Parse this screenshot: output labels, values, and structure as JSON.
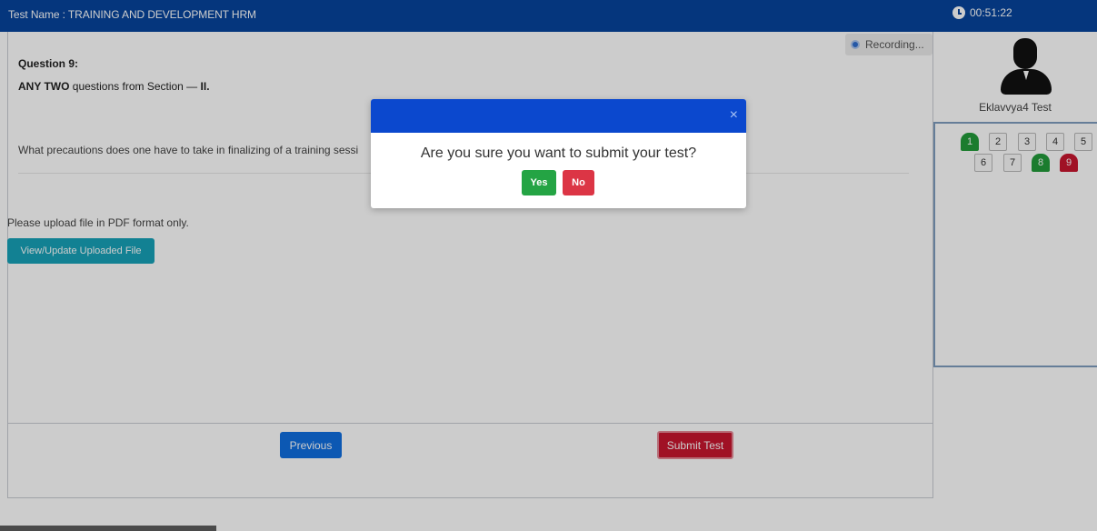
{
  "header": {
    "test_name": "Test Name : TRAINING AND DEVELOPMENT HRM",
    "timer": "00:51:22"
  },
  "recording": {
    "label": "Recording..."
  },
  "question": {
    "title": "Question 9:",
    "instruction_bold": "ANY TWO",
    "instruction_rest": " questions from Section — ",
    "instruction_section": "II.",
    "text": "What precautions does one have to take in finalizing of a training sessi"
  },
  "upload": {
    "note": "Please upload file in PDF format only.",
    "button_label": "View/Update Uploaded File"
  },
  "footer": {
    "previous_label": "Previous",
    "submit_label": "Submit Test"
  },
  "profile": {
    "name": "Eklavvya4 Test"
  },
  "palette": {
    "items": [
      {
        "num": "1",
        "state": "answered"
      },
      {
        "num": "2",
        "state": "not-visited"
      },
      {
        "num": "3",
        "state": "not-visited"
      },
      {
        "num": "4",
        "state": "not-visited"
      },
      {
        "num": "5",
        "state": "not-visited"
      },
      {
        "num": "6",
        "state": "not-visited"
      },
      {
        "num": "7",
        "state": "not-visited"
      },
      {
        "num": "8",
        "state": "answered"
      },
      {
        "num": "9",
        "state": "flagged"
      }
    ]
  },
  "modal": {
    "close_symbol": "×",
    "message": "Are you sure you want to submit your test?",
    "yes_label": "Yes",
    "no_label": "No"
  },
  "colors": {
    "header_bg": "#07449d",
    "modal_header": "#0b48ce",
    "answered": "#229c3a",
    "flagged": "#c8162f",
    "primary": "#0f6fe0",
    "info": "#17a2b8"
  }
}
